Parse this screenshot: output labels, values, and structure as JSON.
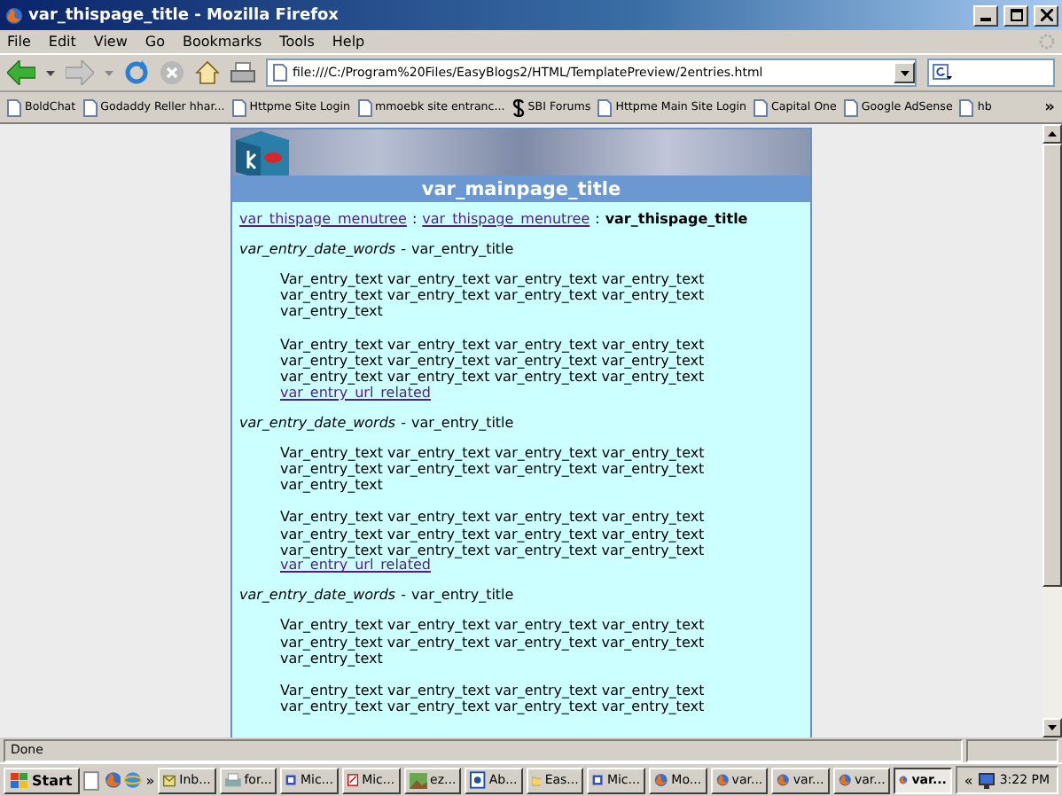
{
  "window": {
    "title": "var_thispage_title - Mozilla Firefox"
  },
  "menu": [
    "File",
    "Edit",
    "View",
    "Go",
    "Bookmarks",
    "Tools",
    "Help"
  ],
  "address": {
    "value": "file:///C:/Program%20Files/EasyBlogs2/HTML/TemplatePreview/2entries.html"
  },
  "bookmarks": [
    {
      "label": "BoldChat",
      "kind": "page"
    },
    {
      "label": "Godaddy Reller hhar...",
      "kind": "page"
    },
    {
      "label": "Httpme Site Login",
      "kind": "page"
    },
    {
      "label": "mmoebk site entranc...",
      "kind": "page"
    },
    {
      "label": "SBI Forums",
      "kind": "sbi"
    },
    {
      "label": "Httpme Main Site Login",
      "kind": "page"
    },
    {
      "label": "Capital One",
      "kind": "page"
    },
    {
      "label": "Google AdSense",
      "kind": "page"
    },
    {
      "label": "hb",
      "kind": "page"
    }
  ],
  "bookmarks_more": "»",
  "page": {
    "main_title": "var_mainpage_title",
    "breadcrumb": {
      "links": [
        "var_thispage_menutree",
        "var_thispage_menutree"
      ],
      "separator": ":",
      "current": "var_thispage_title"
    },
    "entries": [
      {
        "date_words": "var_entry_date_words",
        "dash": "-",
        "title": "var_entry_title",
        "paragraphs": [
          "Var_entry_text var_entry_text var_entry_text var_entry_text\nvar_entry_text var_entry_text var_entry_text var_entry_text\nvar_entry_text",
          "Var_entry_text var_entry_text var_entry_text var_entry_text\nvar_entry_text var_entry_text var_entry_text var_entry_text\nvar_entry_text var_entry_text var_entry_text var_entry_text"
        ],
        "link": "var_entry_url_related"
      },
      {
        "date_words": "var_entry_date_words",
        "dash": "-",
        "title": "var_entry_title",
        "paragraphs": [
          "Var_entry_text var_entry_text var_entry_text var_entry_text\nvar_entry_text var_entry_text var_entry_text var_entry_text\nvar_entry_text",
          "Var_entry_text var_entry_text var_entry_text var_entry_text\nvar_entry_text var_entry_text var_entry_text var_entry_text\nvar_entry_text var_entry_text var_entry_text var_entry_text"
        ],
        "link": "var_entry_url_related"
      },
      {
        "date_words": "var_entry_date_words",
        "dash": "-",
        "title": "var_entry_title",
        "paragraphs": [
          "Var_entry_text var_entry_text var_entry_text var_entry_text\nvar_entry_text var_entry_text var_entry_text var_entry_text\nvar_entry_text",
          "Var_entry_text var_entry_text var_entry_text var_entry_text\nvar_entry_text var_entry_text var_entry_text var_entry_text"
        ]
      }
    ]
  },
  "status_bar": {
    "text": "Done"
  },
  "taskbar": {
    "start": "Start",
    "more": "»",
    "tray_more": "«",
    "clock": "3:22 PM",
    "tasks": [
      {
        "label": "Inb...",
        "kind": "mail",
        "selected": false
      },
      {
        "label": "for...",
        "kind": "gear",
        "selected": false
      },
      {
        "label": "Mic...",
        "kind": "app",
        "selected": false
      },
      {
        "label": "Mic...",
        "kind": "pdf",
        "selected": false
      },
      {
        "label": "ez...",
        "kind": "image",
        "selected": false
      },
      {
        "label": "Ab...",
        "kind": "doc",
        "selected": false
      },
      {
        "label": "Eas...",
        "kind": "folder",
        "selected": false
      },
      {
        "label": "Mic...",
        "kind": "app",
        "selected": false
      },
      {
        "label": "Mo...",
        "kind": "firefox",
        "selected": false
      },
      {
        "label": "var...",
        "kind": "firefox",
        "selected": false
      },
      {
        "label": "var...",
        "kind": "firefox",
        "selected": false
      },
      {
        "label": "var...",
        "kind": "firefox",
        "selected": false
      },
      {
        "label": "var...",
        "kind": "firefox",
        "selected": true
      }
    ]
  }
}
